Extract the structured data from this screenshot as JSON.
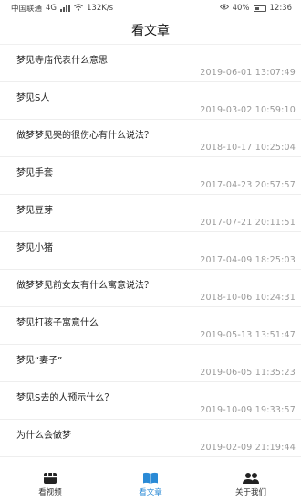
{
  "status_bar": {
    "carrier": "中国联通",
    "network": "4G",
    "speed": "132K/s",
    "battery": "40%",
    "time": "12:36"
  },
  "header": {
    "title": "看文章"
  },
  "articles": [
    {
      "title": "梦见寺庙代表什么意思",
      "date": "2019-06-01 13:07:49"
    },
    {
      "title": "梦见S人",
      "date": "2019-03-02 10:59:10"
    },
    {
      "title": "做梦梦见哭的很伤心有什么说法？",
      "date": "2018-10-17 10:25:04"
    },
    {
      "title": "梦见手套",
      "date": "2017-04-23 20:57:57"
    },
    {
      "title": "梦见豆芽",
      "date": "2017-07-21 20:11:51"
    },
    {
      "title": "梦见小猪",
      "date": "2017-04-09 18:25:03"
    },
    {
      "title": "做梦梦见前女友有什么寓意说法？",
      "date": "2018-10-06 10:24:31"
    },
    {
      "title": "梦见打孩子寓意什么",
      "date": "2019-05-13 13:51:47"
    },
    {
      "title": "梦见“妻子”",
      "date": "2019-06-05 11:35:23"
    },
    {
      "title": "梦见S去的人预示什么？",
      "date": "2019-10-09 19:33:57"
    },
    {
      "title": "为什么会做梦",
      "date": "2019-02-09 21:19:44"
    }
  ],
  "tabs": [
    {
      "label": "看视频",
      "icon": "video-box-icon",
      "active": false
    },
    {
      "label": "看文章",
      "icon": "book-icon",
      "active": true
    },
    {
      "label": "关于我们",
      "icon": "people-icon",
      "active": false
    }
  ],
  "colors": {
    "accent": "#2a8ad6",
    "date_text": "#9a9a9a",
    "divider": "#eeeeee"
  }
}
